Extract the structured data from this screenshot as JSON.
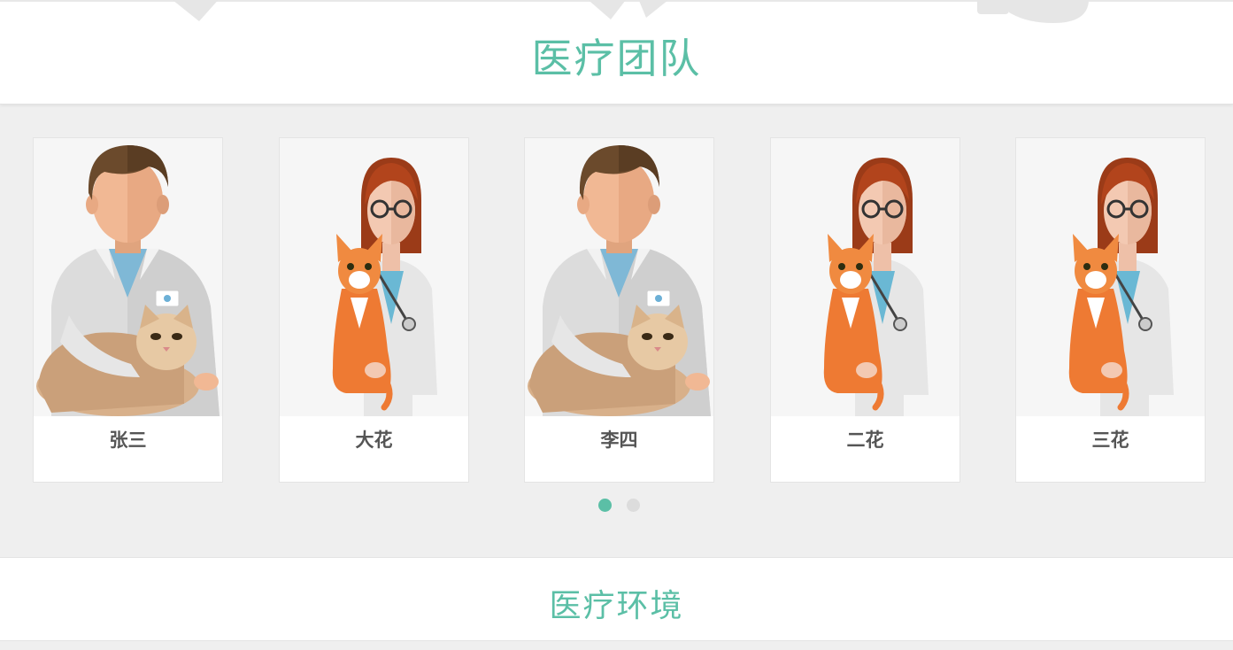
{
  "team_section": {
    "title": "医疗团队"
  },
  "team_members": [
    {
      "name": "张三",
      "avatar": "male-vet-with-cat"
    },
    {
      "name": "大花",
      "avatar": "female-vet-with-orange-cat"
    },
    {
      "name": "李四",
      "avatar": "male-vet-with-cat"
    },
    {
      "name": "二花",
      "avatar": "female-vet-with-orange-cat"
    },
    {
      "name": "三花",
      "avatar": "female-vet-with-orange-cat"
    }
  ],
  "carousel": {
    "pages": 2,
    "active_page": 1,
    "active_color": "#5bbfa6",
    "inactive_color": "#dcdcdc"
  },
  "environment_section": {
    "title": "医疗环境"
  },
  "colors": {
    "accent": "#5bbfa6",
    "background": "#efefef",
    "card": "#ffffff",
    "name_text": "#555555"
  }
}
